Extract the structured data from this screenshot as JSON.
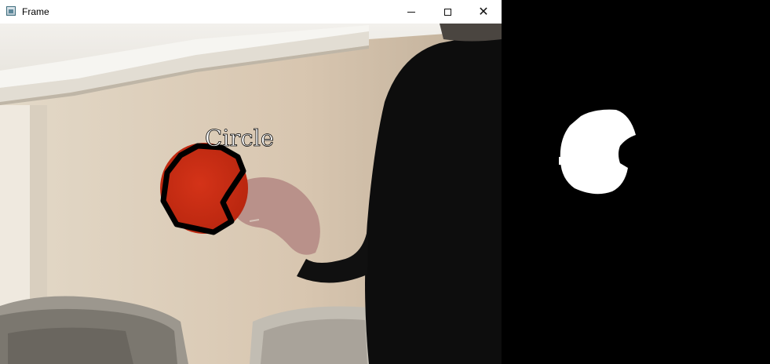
{
  "window": {
    "title": "Frame",
    "app_icon": "opencv-window-icon",
    "controls": {
      "minimize_icon": "minimize-icon",
      "maximize_icon": "maximize-icon",
      "close_icon": "close-icon",
      "close_glyph": "✕"
    }
  },
  "frame": {
    "detected_shape_label": "Circle",
    "object_color": "#c42a12",
    "contour_color": "#000000"
  },
  "mask": {
    "background_color": "#000000",
    "blob_color": "#ffffff"
  }
}
